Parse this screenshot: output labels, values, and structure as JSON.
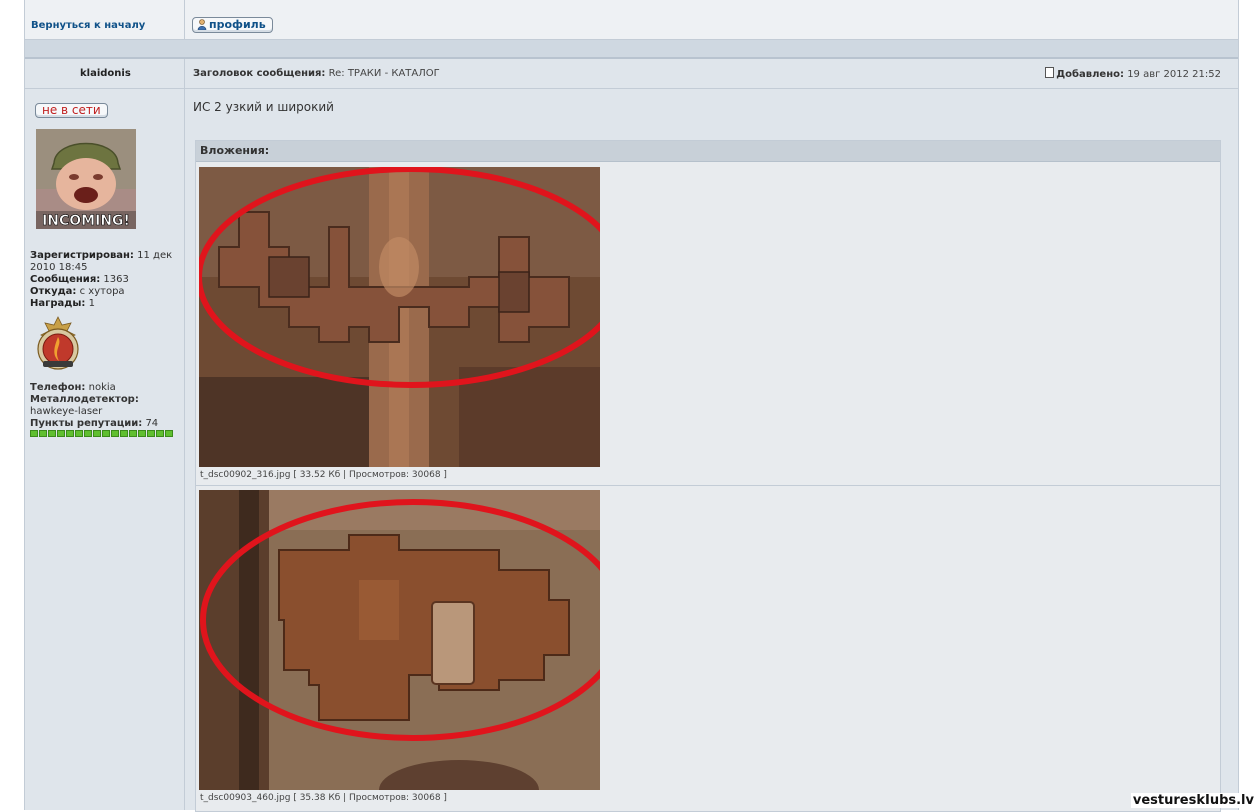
{
  "nav": {
    "back_label": "Вернуться к началу",
    "profile_label": "профиль"
  },
  "post": {
    "author": "klaidonis",
    "subject_label": "Заголовок сообщения:",
    "subject": "Re: ТРАКИ - КАТАЛОГ",
    "posted_label": "Добавлено:",
    "posted_date": "19 авг 2012 21:52",
    "body_text": "ИС 2 узкий и широкий"
  },
  "user": {
    "status_label": "не в сети",
    "registered_label": "Зарегистрирован:",
    "registered_value": "11 дек",
    "registered_value2": "2010 18:45",
    "posts_label": "Сообщения:",
    "posts_value": "1363",
    "location_label": "Откуда:",
    "location_value": "с хутора",
    "awards_label": "Награды:",
    "awards_value": "1",
    "phone_label": "Телефон:",
    "phone_value": "nokia",
    "detector_label": "Металлодетектор:",
    "detector_value": "hawkeye-laser",
    "rep_label": "Пункты репутации:",
    "rep_value": "74",
    "avatar_text": "INCOMING!"
  },
  "attachments": {
    "header": "Вложения:",
    "items": [
      {
        "caption": "t_dsc00902_316.jpg [ 33.52 Кб | Просмотров: 30068 ]"
      },
      {
        "caption": "t_dsc00903_460.jpg [ 35.38 Кб | Просмотров: 30068 ]"
      }
    ]
  },
  "watermark": "vestureskIubs.lv",
  "colors": {
    "link": "#105289",
    "offline": "#c02020",
    "rep_green": "#5fbf2f",
    "highlight_ellipse": "#e0141c",
    "frame_bg": "#dfe5eb"
  }
}
